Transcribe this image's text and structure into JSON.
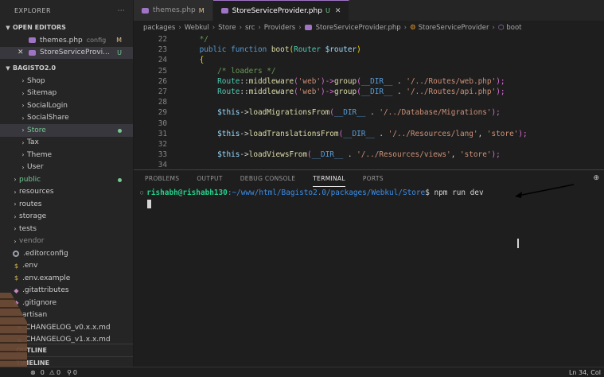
{
  "sidebar": {
    "title": "EXPLORER",
    "more": "···",
    "open_editors_label": "OPEN EDITORS",
    "open_editors": [
      {
        "name": "themes.php",
        "hint": "config",
        "badge": "M"
      },
      {
        "name": "StoreServiceProvi...",
        "badge": "U"
      }
    ],
    "project_label": "BAGISTO2.0",
    "tree": [
      {
        "label": "Shop"
      },
      {
        "label": "Sitemap"
      },
      {
        "label": "SocialLogin"
      },
      {
        "label": "SocialShare"
      },
      {
        "label": "Store"
      },
      {
        "label": "Tax"
      },
      {
        "label": "Theme"
      },
      {
        "label": "User"
      },
      {
        "label": "public"
      },
      {
        "label": "resources"
      },
      {
        "label": "routes"
      },
      {
        "label": "storage"
      },
      {
        "label": "tests"
      },
      {
        "label": "vendor"
      },
      {
        "label": ".editorconfig"
      },
      {
        "label": ".env"
      },
      {
        "label": ".env.example"
      },
      {
        "label": ".gitattributes"
      },
      {
        "label": ".gitignore"
      },
      {
        "label": "artisan"
      },
      {
        "label": "CHANGELOG_v0.x.x.md"
      },
      {
        "label": "CHANGELOG_v1.x.x.md"
      }
    ],
    "outline_label": "OUTLINE",
    "timeline_label": "TIMELINE"
  },
  "tabs": [
    {
      "name": "themes.php",
      "badge": "M"
    },
    {
      "name": "StoreServiceProvider.php",
      "badge": "U"
    }
  ],
  "breadcrumb": [
    "packages",
    "Webkul",
    "Store",
    "src",
    "Providers",
    "StoreServiceProvider.php",
    "StoreServiceProvider",
    "boot"
  ],
  "code": [
    {
      "n": "22",
      "segs": [
        {
          "t": "    */",
          "c": "#6a9955"
        }
      ]
    },
    {
      "n": "23",
      "segs": [
        {
          "t": "    ",
          "c": "#d4d4d4"
        },
        {
          "t": "public function ",
          "c": "#569cd6"
        },
        {
          "t": "boot",
          "c": "#dcdcaa"
        },
        {
          "t": "(",
          "c": "#ffd700"
        },
        {
          "t": "Router ",
          "c": "#4ec9b0"
        },
        {
          "t": "$router",
          "c": "#9cdcfe"
        },
        {
          "t": ")",
          "c": "#ffd700"
        }
      ]
    },
    {
      "n": "24",
      "segs": [
        {
          "t": "    {",
          "c": "#ffd700"
        }
      ]
    },
    {
      "n": "25",
      "segs": [
        {
          "t": "        /* loaders */",
          "c": "#6a9955"
        }
      ]
    },
    {
      "n": "26",
      "segs": [
        {
          "t": "        Route",
          "c": "#4ec9b0"
        },
        {
          "t": "::",
          "c": "#d4d4d4"
        },
        {
          "t": "middleware",
          "c": "#dcdcaa"
        },
        {
          "t": "(",
          "c": "#da70d6"
        },
        {
          "t": "'web'",
          "c": "#ce9178"
        },
        {
          "t": ")->",
          "c": "#da70d6"
        },
        {
          "t": "group",
          "c": "#dcdcaa"
        },
        {
          "t": "(",
          "c": "#da70d6"
        },
        {
          "t": "__DIR__",
          "c": "#569cd6"
        },
        {
          "t": " . ",
          "c": "#d4d4d4"
        },
        {
          "t": "'/../Routes/web.php'",
          "c": "#ce9178"
        },
        {
          "t": ");",
          "c": "#da70d6"
        }
      ]
    },
    {
      "n": "27",
      "segs": [
        {
          "t": "        Route",
          "c": "#4ec9b0"
        },
        {
          "t": "::",
          "c": "#d4d4d4"
        },
        {
          "t": "middleware",
          "c": "#dcdcaa"
        },
        {
          "t": "(",
          "c": "#da70d6"
        },
        {
          "t": "'web'",
          "c": "#ce9178"
        },
        {
          "t": ")->",
          "c": "#da70d6"
        },
        {
          "t": "group",
          "c": "#dcdcaa"
        },
        {
          "t": "(",
          "c": "#da70d6"
        },
        {
          "t": "__DIR__",
          "c": "#569cd6"
        },
        {
          "t": " . ",
          "c": "#d4d4d4"
        },
        {
          "t": "'/../Routes/api.php'",
          "c": "#ce9178"
        },
        {
          "t": ");",
          "c": "#da70d6"
        }
      ]
    },
    {
      "n": "28",
      "segs": [
        {
          "t": "",
          "c": "#d4d4d4"
        }
      ]
    },
    {
      "n": "29",
      "segs": [
        {
          "t": "        $this",
          "c": "#9cdcfe"
        },
        {
          "t": "->",
          "c": "#d4d4d4"
        },
        {
          "t": "loadMigrationsFrom",
          "c": "#dcdcaa"
        },
        {
          "t": "(",
          "c": "#da70d6"
        },
        {
          "t": "__DIR__",
          "c": "#569cd6"
        },
        {
          "t": " . ",
          "c": "#d4d4d4"
        },
        {
          "t": "'/../Database/Migrations'",
          "c": "#ce9178"
        },
        {
          "t": ");",
          "c": "#da70d6"
        }
      ]
    },
    {
      "n": "30",
      "segs": [
        {
          "t": "",
          "c": "#d4d4d4"
        }
      ]
    },
    {
      "n": "31",
      "segs": [
        {
          "t": "        $this",
          "c": "#9cdcfe"
        },
        {
          "t": "->",
          "c": "#d4d4d4"
        },
        {
          "t": "loadTranslationsFrom",
          "c": "#dcdcaa"
        },
        {
          "t": "(",
          "c": "#da70d6"
        },
        {
          "t": "__DIR__",
          "c": "#569cd6"
        },
        {
          "t": " . ",
          "c": "#d4d4d4"
        },
        {
          "t": "'/../Resources/lang'",
          "c": "#ce9178"
        },
        {
          "t": ", ",
          "c": "#d4d4d4"
        },
        {
          "t": "'store'",
          "c": "#ce9178"
        },
        {
          "t": ");",
          "c": "#da70d6"
        }
      ]
    },
    {
      "n": "32",
      "segs": [
        {
          "t": "",
          "c": "#d4d4d4"
        }
      ]
    },
    {
      "n": "33",
      "segs": [
        {
          "t": "        $this",
          "c": "#9cdcfe"
        },
        {
          "t": "->",
          "c": "#d4d4d4"
        },
        {
          "t": "loadViewsFrom",
          "c": "#dcdcaa"
        },
        {
          "t": "(",
          "c": "#da70d6"
        },
        {
          "t": "__DIR__",
          "c": "#569cd6"
        },
        {
          "t": " . ",
          "c": "#d4d4d4"
        },
        {
          "t": "'/../Resources/views'",
          "c": "#ce9178"
        },
        {
          "t": ", ",
          "c": "#d4d4d4"
        },
        {
          "t": "'store'",
          "c": "#ce9178"
        },
        {
          "t": ");",
          "c": "#da70d6"
        }
      ]
    },
    {
      "n": "34",
      "segs": [
        {
          "t": "",
          "c": "#d4d4d4"
        }
      ]
    }
  ],
  "panel": {
    "tabs": [
      "PROBLEMS",
      "OUTPUT",
      "DEBUG CONSOLE",
      "TERMINAL",
      "PORTS"
    ],
    "active_tab": "TERMINAL"
  },
  "terminal": {
    "user": "rishabh@rishabh130",
    "path": ":~/www/html/Bagisto2.0/packages/Webkul/Store",
    "prompt": "$",
    "command": "npm run dev"
  },
  "status": {
    "errors": "0",
    "warnings": "0",
    "ports": "0",
    "position": "Ln 34, Col"
  },
  "colors": {
    "accent": "#a074c4",
    "terminal_user": "#23d18b",
    "terminal_path": "#3b8eea"
  }
}
